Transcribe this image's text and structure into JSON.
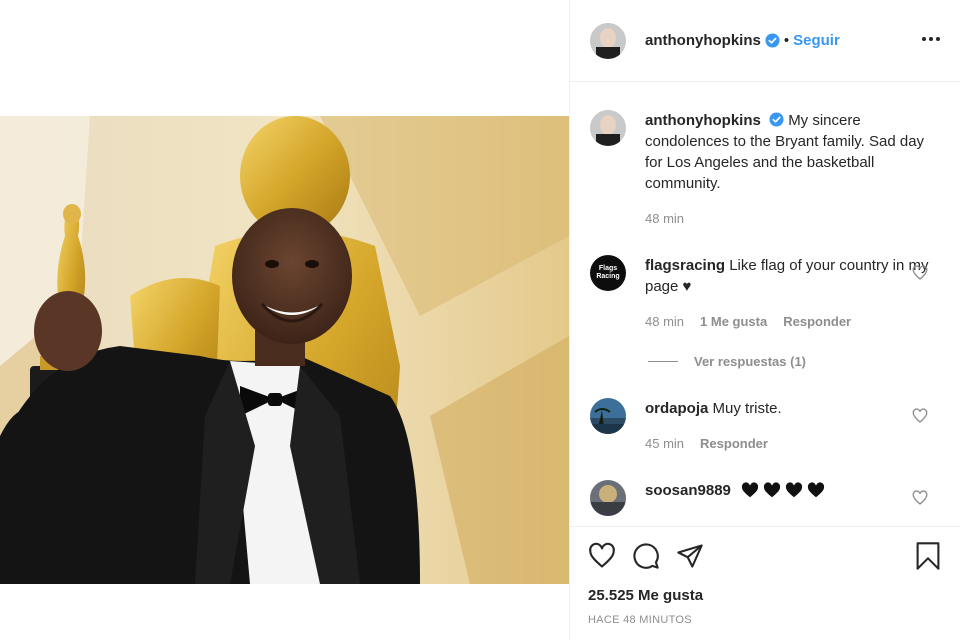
{
  "post": {
    "author": "anthonyhopkins",
    "follow_label": "Seguir",
    "separator": "•"
  },
  "comments": [
    {
      "user": "anthonyhopkins",
      "verified": true,
      "text": "My sincere condolences to the Bryant family. Sad day for Los Angeles and the basketball community.",
      "time": "48 min"
    },
    {
      "user": "flagsracing",
      "avatar_text": "Flags Racing",
      "text": "Like flag of your country in my page ♥",
      "time": "48 min",
      "likes": "1 Me gusta",
      "reply_label": "Responder",
      "view_replies": "Ver respuestas (1)"
    },
    {
      "user": "ordapoja",
      "text": "Muy triste.",
      "time": "45 min",
      "reply_label": "Responder"
    },
    {
      "user": "soosan9889",
      "text": "🖤🖤🖤🖤"
    }
  ],
  "footer": {
    "likes": "25.525 Me gusta",
    "time_ago": "HACE 48 MINUTOS"
  },
  "colors": {
    "link": "#3897f0",
    "muted": "#8e8e8e",
    "text": "#262626",
    "verified": "#3897f0"
  },
  "icons": [
    "more-icon",
    "heart-icon",
    "comment-icon",
    "share-icon",
    "bookmark-icon",
    "verified-badge-icon"
  ]
}
